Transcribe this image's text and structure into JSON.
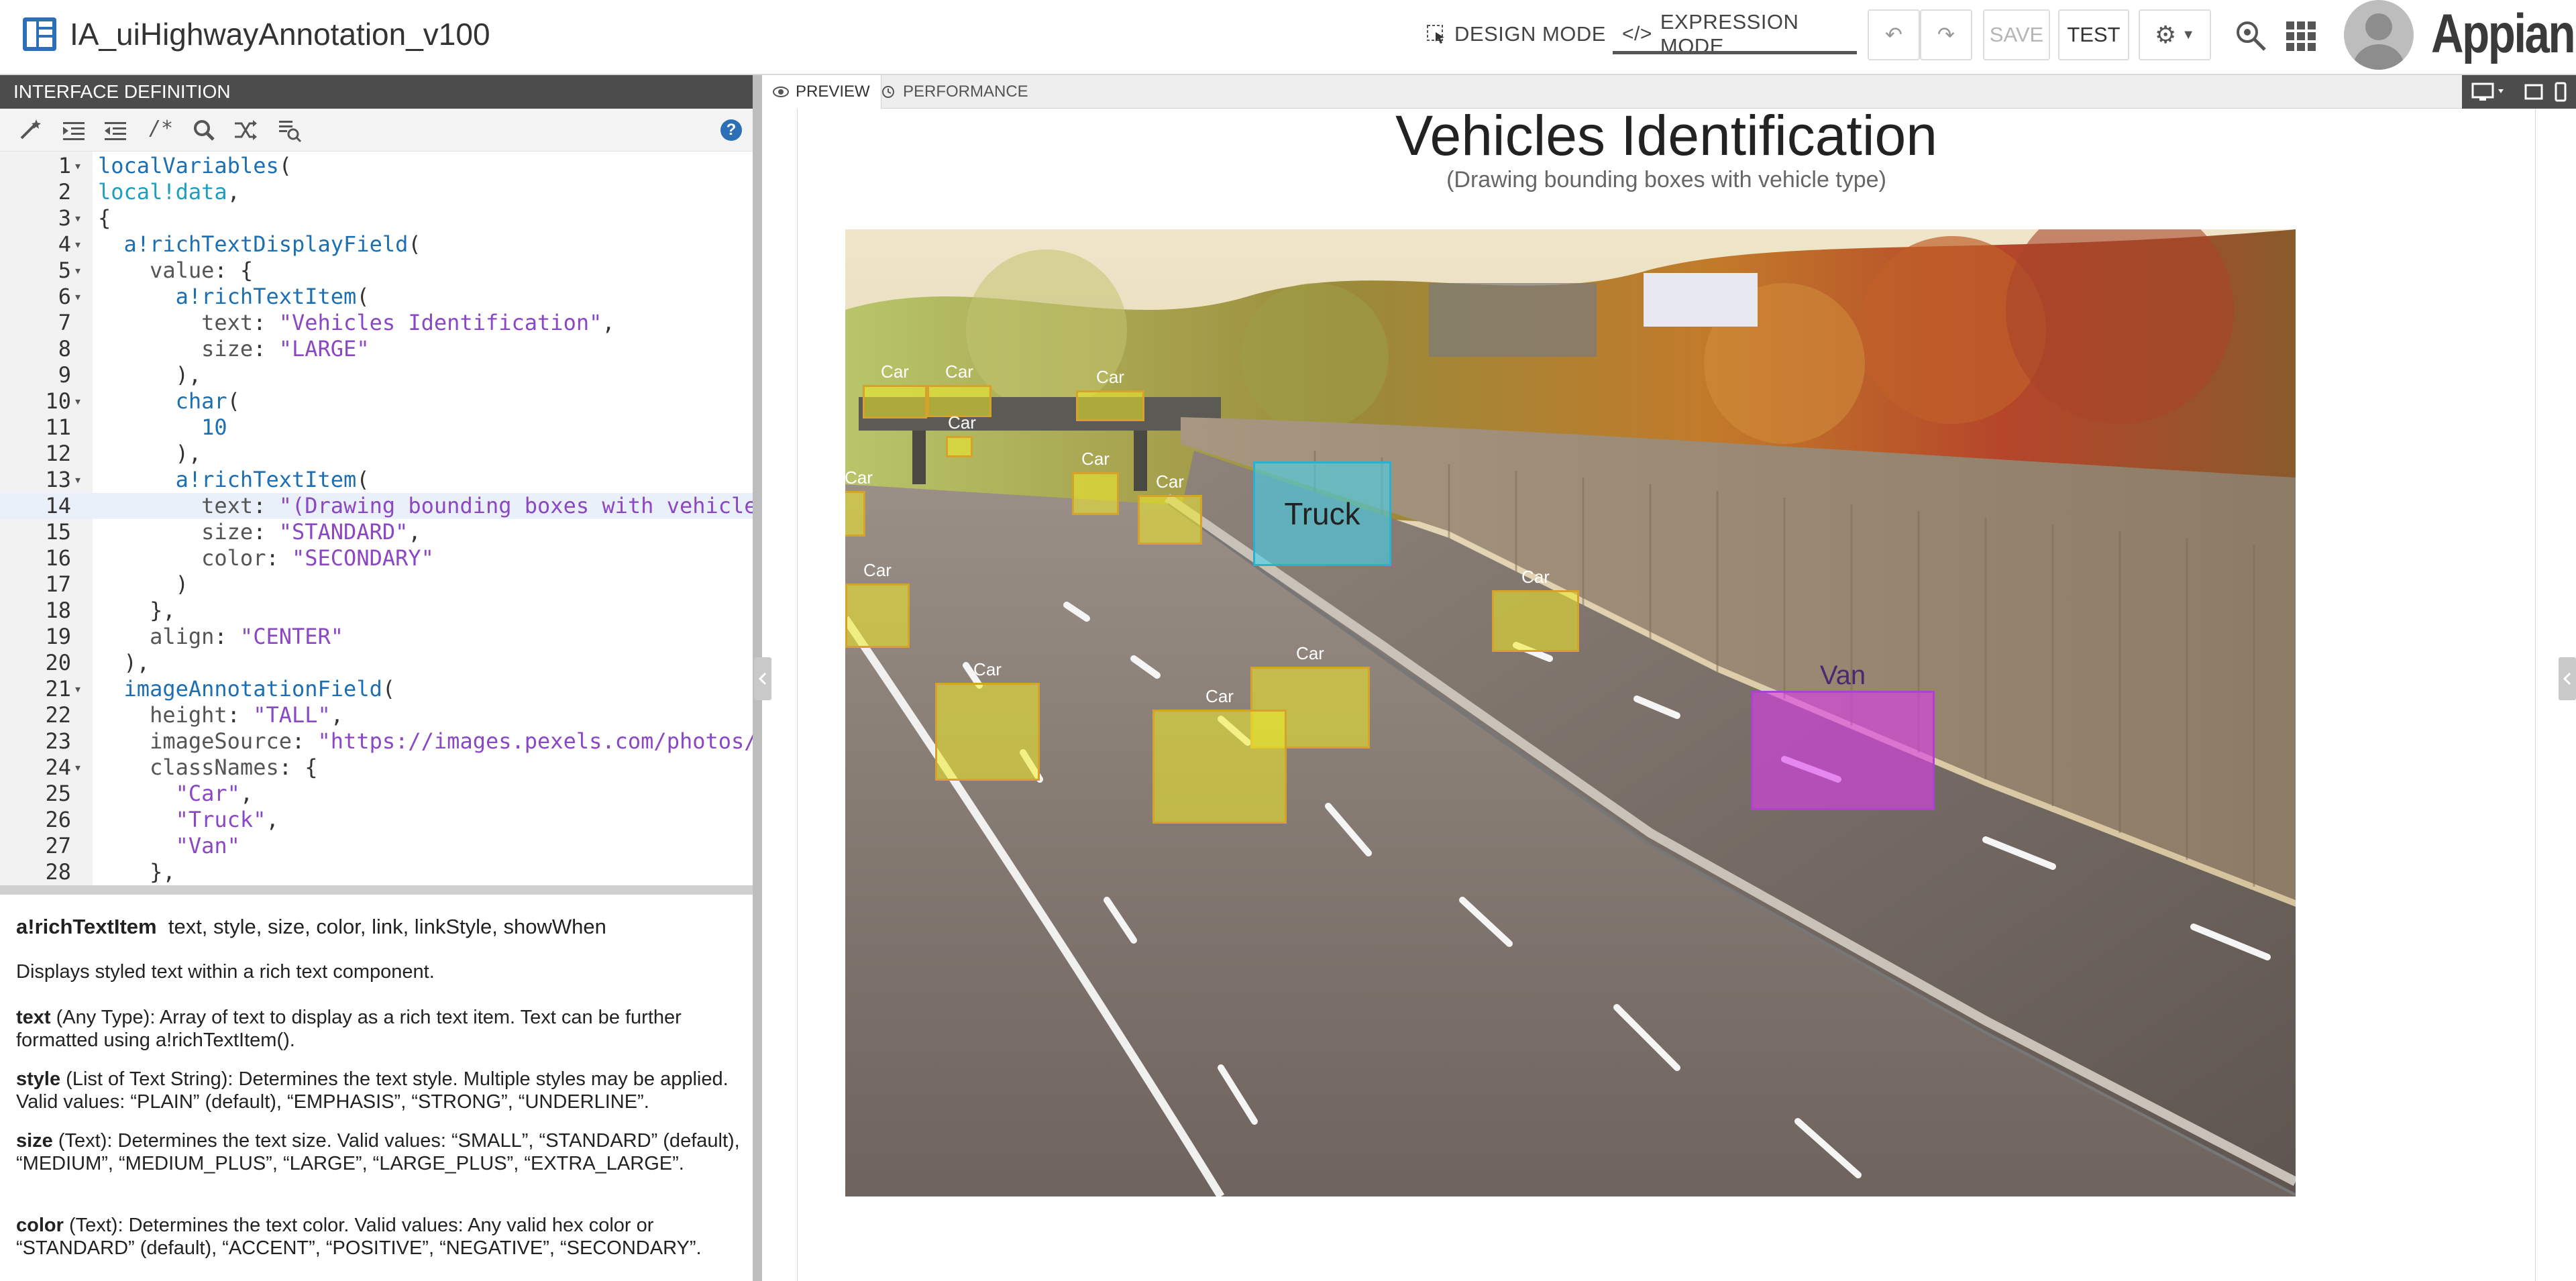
{
  "app": {
    "title": "IA_uiHighwayAnnotation_v100",
    "brand": "Appian"
  },
  "toolbar": {
    "design_mode_label": "DESIGN MODE",
    "expression_mode_label": "EXPRESSION MODE",
    "save_label": "SAVE",
    "test_label": "TEST"
  },
  "left_panel": {
    "header": "INTERFACE DEFINITION",
    "code_lines": [
      {
        "n": "1",
        "fold": true,
        "html": "<span class='t-fn'>localVariables</span><span class='t-punc'>(</span>"
      },
      {
        "n": "2",
        "fold": false,
        "html": "<span class='t-var'>local!data</span><span class='t-punc'>,</span>"
      },
      {
        "n": "3",
        "fold": true,
        "html": "<span class='t-punc'>{</span>"
      },
      {
        "n": "4",
        "fold": true,
        "html": "  <span class='t-fn'>a!richTextDisplayField</span><span class='t-punc'>(</span>"
      },
      {
        "n": "5",
        "fold": true,
        "html": "    <span class='t-key'>value</span><span class='t-punc'>: {</span>"
      },
      {
        "n": "6",
        "fold": true,
        "html": "      <span class='t-fn'>a!richTextItem</span><span class='t-punc'>(</span>"
      },
      {
        "n": "7",
        "fold": false,
        "html": "        <span class='t-key'>text</span><span class='t-punc'>: </span><span class='t-str'>\"Vehicles Identification\"</span><span class='t-punc'>,</span>"
      },
      {
        "n": "8",
        "fold": false,
        "html": "        <span class='t-key'>size</span><span class='t-punc'>: </span><span class='t-str'>\"LARGE\"</span>"
      },
      {
        "n": "9",
        "fold": false,
        "html": "      <span class='t-punc'>),</span>"
      },
      {
        "n": "10",
        "fold": true,
        "html": "      <span class='t-fn'>char</span><span class='t-punc'>(</span>"
      },
      {
        "n": "11",
        "fold": false,
        "html": "        <span class='t-num'>10</span>"
      },
      {
        "n": "12",
        "fold": false,
        "html": "      <span class='t-punc'>),</span>"
      },
      {
        "n": "13",
        "fold": true,
        "html": "      <span class='t-fn'>a!richTextItem</span><span class='t-punc'>(</span>"
      },
      {
        "n": "14",
        "fold": false,
        "active": true,
        "html": "        <span class='t-key'>text</span><span class='t-punc'>: </span><span class='t-str'>\"(Drawing bounding boxes with vehicle</span>"
      },
      {
        "n": "15",
        "fold": false,
        "html": "        <span class='t-key'>size</span><span class='t-punc'>: </span><span class='t-str'>\"STANDARD\"</span><span class='t-punc'>,</span>"
      },
      {
        "n": "16",
        "fold": false,
        "html": "        <span class='t-key'>color</span><span class='t-punc'>: </span><span class='t-str'>\"SECONDARY\"</span>"
      },
      {
        "n": "17",
        "fold": false,
        "html": "      <span class='t-punc'>)</span>"
      },
      {
        "n": "18",
        "fold": false,
        "html": "    <span class='t-punc'>},</span>"
      },
      {
        "n": "19",
        "fold": false,
        "html": "    <span class='t-key'>align</span><span class='t-punc'>: </span><span class='t-str'>\"CENTER\"</span>"
      },
      {
        "n": "20",
        "fold": false,
        "html": "  <span class='t-punc'>),</span>"
      },
      {
        "n": "21",
        "fold": true,
        "html": "  <span class='t-fn'>imageAnnotationField</span><span class='t-punc'>(</span>"
      },
      {
        "n": "22",
        "fold": false,
        "html": "    <span class='t-key'>height</span><span class='t-punc'>: </span><span class='t-str'>\"TALL\"</span><span class='t-punc'>,</span>"
      },
      {
        "n": "23",
        "fold": false,
        "html": "    <span class='t-key'>imageSource</span><span class='t-punc'>: </span><span class='t-str'>\"https://images.pexels.com/photos/</span>"
      },
      {
        "n": "24",
        "fold": true,
        "html": "    <span class='t-key'>classNames</span><span class='t-punc'>: {</span>"
      },
      {
        "n": "25",
        "fold": false,
        "html": "      <span class='t-str'>\"Car\"</span><span class='t-punc'>,</span>"
      },
      {
        "n": "26",
        "fold": false,
        "html": "      <span class='t-str'>\"Truck\"</span><span class='t-punc'>,</span>"
      },
      {
        "n": "27",
        "fold": false,
        "html": "      <span class='t-str'>\"Van\"</span>"
      },
      {
        "n": "28",
        "fold": false,
        "html": "    <span class='t-punc'>},</span>"
      }
    ],
    "doc": {
      "signature_name": "a!richTextItem",
      "signature_params": "text, style, size, color, link, linkStyle, showWhen",
      "summary": "Displays styled text within a rich text component.",
      "params": [
        {
          "name": "text",
          "desc": " (Any Type): Array of text to display as a rich text item. Text can be further formatted using a!richTextItem()."
        },
        {
          "name": "style",
          "desc": " (List of Text String): Determines the text style. Multiple styles may be applied. Valid values: “PLAIN” (default), “EMPHASIS”, “STRONG”, “UNDERLINE”."
        },
        {
          "name": "size",
          "desc": " (Text): Determines the text size. Valid values: “SMALL”, “STANDARD” (default), “MEDIUM”, “MEDIUM_PLUS”, “LARGE”, “LARGE_PLUS”, “EXTRA_LARGE”."
        },
        {
          "name": "color",
          "desc": " (Text): Determines the text color. Valid values: Any valid hex color or “STANDARD” (default), “ACCENT”, “POSITIVE”, “NEGATIVE”, “SECONDARY”."
        }
      ]
    }
  },
  "preview": {
    "tabs": [
      "PREVIEW",
      "PERFORMANCE"
    ],
    "title": "Vehicles Identification",
    "subtitle": "(Drawing bounding boxes with vehicle type)",
    "annotations": [
      {
        "label": "Car",
        "cls": "car"
      },
      {
        "label": "Car",
        "cls": "car"
      },
      {
        "label": "Car",
        "cls": "car"
      },
      {
        "label": "Car",
        "cls": "car"
      },
      {
        "label": "Car",
        "cls": "car"
      },
      {
        "label": "Car",
        "cls": "car"
      },
      {
        "label": "Car",
        "cls": "car"
      },
      {
        "label": "Truck",
        "cls": "truck"
      },
      {
        "label": "Car",
        "cls": "car"
      },
      {
        "label": "Car",
        "cls": "car"
      },
      {
        "label": "Car",
        "cls": "car"
      },
      {
        "label": "Car",
        "cls": "car"
      },
      {
        "label": "Car",
        "cls": "car"
      },
      {
        "label": "Van",
        "cls": "van"
      }
    ]
  },
  "colors": {
    "header_dark": "#4c4c4c",
    "accent_blue": "#2d6fb6",
    "car_box": "#f0ec28",
    "truck_box": "#46d2eb",
    "van_box": "#dc3ceb"
  }
}
